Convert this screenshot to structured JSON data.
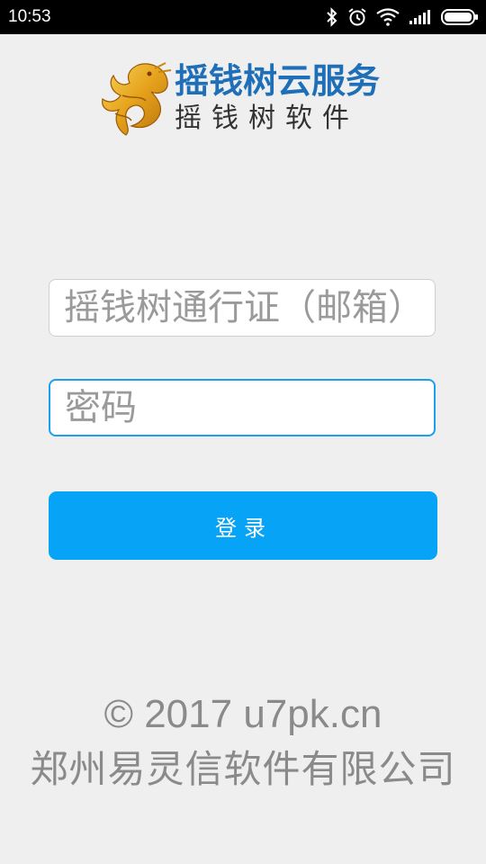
{
  "status_bar": {
    "time": "10:53",
    "icons": [
      "bluetooth-icon",
      "alarm-icon",
      "wifi-icon",
      "signal-icon",
      "battery-icon"
    ]
  },
  "logo": {
    "title": "摇钱树云服务",
    "subtitle": "摇钱树软件",
    "title_color": "#1f6fb8",
    "emblem": "golden-dragon-icon"
  },
  "login_form": {
    "username_placeholder": "摇钱树通行证（邮箱）",
    "username_value": "",
    "password_placeholder": "密码",
    "password_value": "",
    "login_label": "登录"
  },
  "footer": {
    "copyright": "© 2017 u7pk.cn",
    "company": "郑州易灵信软件有限公司"
  },
  "colors": {
    "accent": "#06a3f7",
    "focus_border": "#1aa0ef",
    "background": "#efefef",
    "footer_text": "#8a8a8a"
  }
}
